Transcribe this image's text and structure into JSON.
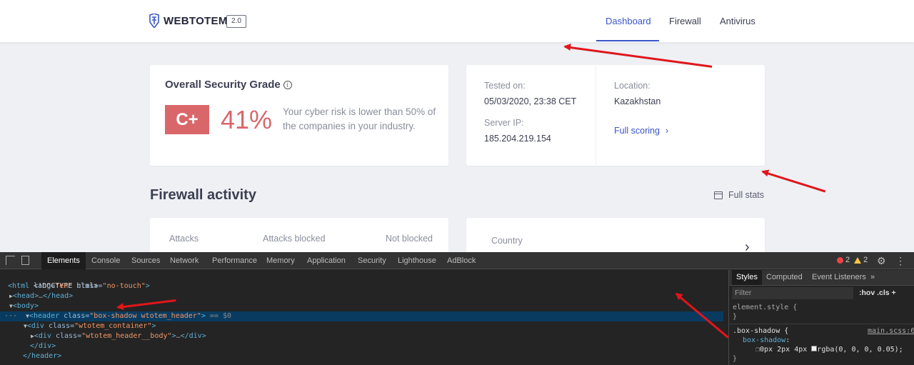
{
  "header": {
    "brand": "WEBTOTEM",
    "version": "2.0",
    "nav": [
      {
        "label": "Dashboard",
        "active": true
      },
      {
        "label": "Firewall",
        "active": false
      },
      {
        "label": "Antivirus",
        "active": false
      }
    ]
  },
  "grade_card": {
    "title": "Overall Security Grade",
    "info_icon": "info-icon",
    "grade": "C+",
    "percent": "41%",
    "description": "Your cyber risk is lower than 50% of the companies in your industry.",
    "grade_color": "#d9676a"
  },
  "scan_card": {
    "tested_label": "Tested on:",
    "tested_value": "05/03/2020, 23:38 CET",
    "ip_label": "Server IP:",
    "ip_value": "185.204.219.154",
    "location_label": "Location:",
    "location_value": "Kazakhstan",
    "full_scoring": "Full scoring",
    "link_color": "#3a56c9"
  },
  "firewall": {
    "title": "Firewall activity",
    "full_stats": "Full stats",
    "stats": [
      {
        "label": "Attacks"
      },
      {
        "label": "Attacks blocked"
      },
      {
        "label": "Not blocked"
      }
    ],
    "country_label": "Country"
  },
  "devtools": {
    "tabs": [
      "Elements",
      "Console",
      "Sources",
      "Network",
      "Performance",
      "Memory",
      "Application",
      "Security",
      "Lighthouse",
      "AdBlock"
    ],
    "active_tab": "Elements",
    "errors": "2",
    "warnings": "2",
    "dom": {
      "doctype": "<!DOCTYPE html>",
      "html_tag": "html",
      "html_lang_attr": "lang",
      "html_lang_val": "\"en\"",
      "html_class_attr": "class",
      "html_class_val": "\"no-touch\"",
      "head": "head",
      "body": "body",
      "header_tag": "header",
      "header_class_val": "\"box-shadow wtotem_header\"",
      "selected_marker": "== $0",
      "container_class_val": "\"wtotem_container\"",
      "body_class_val": "\"wtotem_header__body\"",
      "ellipsis": "…",
      "div": "div",
      "class_attr": "class"
    },
    "styles": {
      "tabs": [
        "Styles",
        "Computed",
        "Event Listeners",
        "»"
      ],
      "filter_placeholder": "Filter",
      "flags": ":hov  .cls  +",
      "element_style": "element.style {",
      "close_brace": "}",
      "selector": ".box-shadow {",
      "source": "main.scss:67",
      "property": "box-shadow",
      "value": "0px 2px 4px",
      "color_value": "rgba(0, 0, 0, 0.05);"
    }
  },
  "annotation_color": "#e0161b"
}
